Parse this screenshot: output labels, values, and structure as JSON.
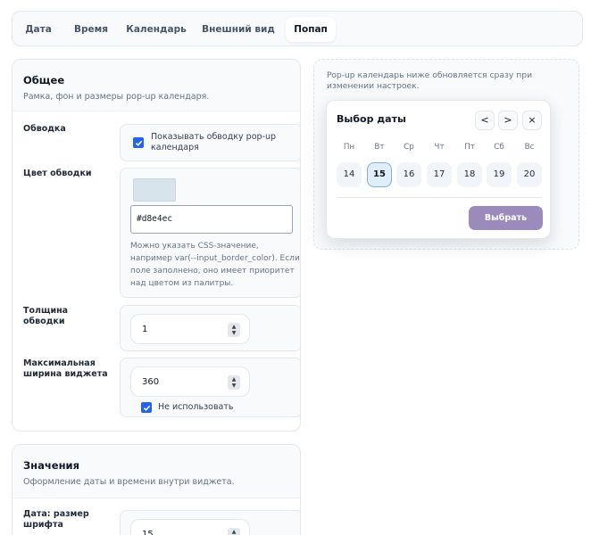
{
  "tabs": [
    "Дата",
    "Время",
    "Календарь",
    "Внешний вид",
    "Попап"
  ],
  "general": {
    "title": "Общее",
    "subtitle": "Рамка, фон и размеры pop-up календаря.",
    "border": {
      "label": "Обводка",
      "checkbox_label": "Показывать обводку pop-up календаря",
      "checked": true
    },
    "border_color": {
      "label": "Цвет обводки",
      "swatch_color": "#d8e4ec",
      "value": "#d8e4ec",
      "hint": "Можно указать CSS-значение, например var(--input_border_color). Если поле заполнено, оно имеет приоритет над цветом из палитры."
    },
    "border_width": {
      "label": "Толщина обводки",
      "value": "1"
    },
    "max_width": {
      "label": "Максимальная ширина виджета",
      "value": "360",
      "checkbox_label": "Не использовать",
      "checked": true
    }
  },
  "values": {
    "title": "Значения",
    "subtitle": "Оформление даты и времени внутри виджета.",
    "date_font_size": {
      "label": "Дата: размер шрифта",
      "value": "15"
    }
  },
  "preview": {
    "text": "Pop-up календарь ниже обновляется сразу при изменении настроек."
  },
  "popup": {
    "title": "Выбор даты",
    "prev": "<",
    "next": ">",
    "close": "×",
    "weekdays": [
      "Пн",
      "Вт",
      "Ср",
      "Чт",
      "Пт",
      "Сб",
      "Вс"
    ],
    "days": [
      "14",
      "15",
      "16",
      "17",
      "18",
      "19",
      "20"
    ],
    "selected_index": 1,
    "select_button": "Выбрать",
    "select_button_color": "#9b8bbd"
  }
}
